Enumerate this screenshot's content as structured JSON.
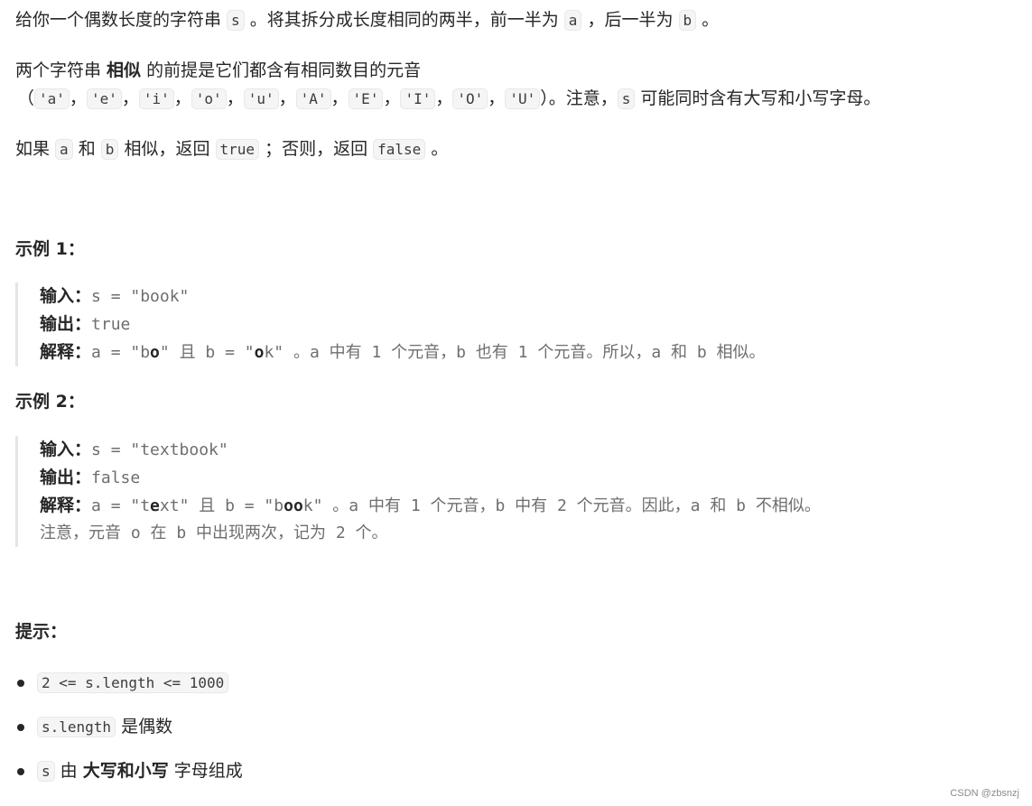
{
  "intro": {
    "line1": {
      "t1": "给你一个偶数长度的字符串 ",
      "c1": "s",
      "t2": " 。将其拆分成长度相同的两半，前一半为 ",
      "c2": "a",
      "t3": " ，后一半为 ",
      "c3": "b",
      "t4": " 。"
    },
    "line2": {
      "t1": "两个字符串 ",
      "strong": "相似",
      "t2": " 的前提是它们都含有相同数目的元音"
    },
    "line3": {
      "open": "（",
      "vowels": [
        "'a'",
        "'e'",
        "'i'",
        "'o'",
        "'u'",
        "'A'",
        "'E'",
        "'I'",
        "'O'",
        "'U'"
      ],
      "sep": "，",
      "close": "）。注意，",
      "c": "s",
      "t": " 可能同时含有大写和小写字母。"
    },
    "line4": {
      "t1": "如果 ",
      "c1": "a",
      "t2": " 和 ",
      "c2": "b",
      "t3": " 相似，返回 ",
      "c3": "true",
      "t4": " ；否则，返回 ",
      "c4": "false",
      "t5": " 。"
    }
  },
  "example1": {
    "title": "示例 1：",
    "input_label": "输入：",
    "input_value": "s = \"book\"",
    "output_label": "输出：",
    "output_value": "true",
    "explain_label": "解释：",
    "explain": {
      "p1": "a = \"b",
      "e1": "o",
      "p2": "\" 且 b = \"",
      "e2": "o",
      "p3": "k\" 。a 中有 1 个元音，b 也有 1 个元音。所以，a 和 b 相似。"
    }
  },
  "example2": {
    "title": "示例 2：",
    "input_label": "输入：",
    "input_value": "s = \"textbook\"",
    "output_label": "输出：",
    "output_value": "false",
    "explain_label": "解释：",
    "explain": {
      "p1": "a = \"t",
      "e1": "e",
      "p2": "xt\" 且 b = \"b",
      "e2": "oo",
      "p3": "k\" 。a 中有 1 个元音，b 中有 2 个元音。因此，a 和 b 不相似。"
    },
    "note": "注意，元音 o 在 b 中出现两次，记为 2 个。"
  },
  "hints": {
    "title": "提示：",
    "item1": {
      "code": "2 <= s.length <= 1000"
    },
    "item2": {
      "code": "s.length",
      "text": " 是偶数"
    },
    "item3": {
      "code": "s",
      "t1": " 由 ",
      "strong": "大写和小写",
      "t2": " 字母组成"
    }
  },
  "watermark": "CSDN @zbsnzj"
}
